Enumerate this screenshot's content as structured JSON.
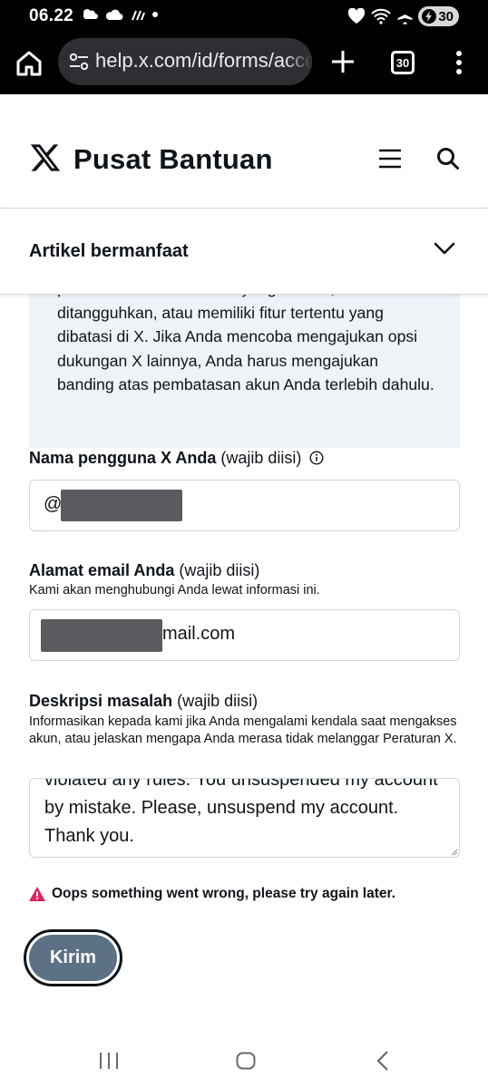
{
  "status_bar": {
    "time": "06.22",
    "battery": "30"
  },
  "browser": {
    "url": "help.x.com/id/forms/account-access/appeals",
    "tab_count": "30"
  },
  "header": {
    "title": "Pusat Bantuan"
  },
  "accordion": {
    "label": "Artikel bermanfaat"
  },
  "info_box": {
    "text": "pembatasan karena akun yang dikunci, ditangguhkan, atau memiliki fitur tertentu yang dibatasi di X. Jika Anda mencoba mengajukan opsi dukungan X lainnya, Anda harus mengajukan banding atas pembatasan akun Anda terlebih dahulu."
  },
  "form": {
    "username": {
      "label": "Nama pengguna X Anda",
      "required": "(wajib diisi)",
      "value_prefix": "@"
    },
    "email": {
      "label": "Alamat email Anda",
      "required": "(wajib diisi)",
      "help": "Kami akan menghubungi Anda lewat informasi ini.",
      "value_suffix": "mail.com"
    },
    "description": {
      "label": "Deskripsi masalah",
      "required": "(wajib diisi)",
      "help": "Informasikan kepada kami jika Anda mengalami kendala saat mengakses akun, atau jelaskan mengapa Anda merasa tidak melanggar Peraturan X.",
      "value": "violated any rules. You unsuspended my account by mistake. Please, unsuspend my account. Thank you."
    },
    "error": "Oops something went wrong, please try again later.",
    "submit_label": "Kirim"
  },
  "colors": {
    "submit_bg": "#5c7185",
    "info_bg": "#eef3f8",
    "error_icon": "#e0245e"
  },
  "icons": [
    "x-logo-icon",
    "menu-icon",
    "search-icon",
    "chevron-down-icon",
    "info-icon",
    "warning-icon"
  ]
}
